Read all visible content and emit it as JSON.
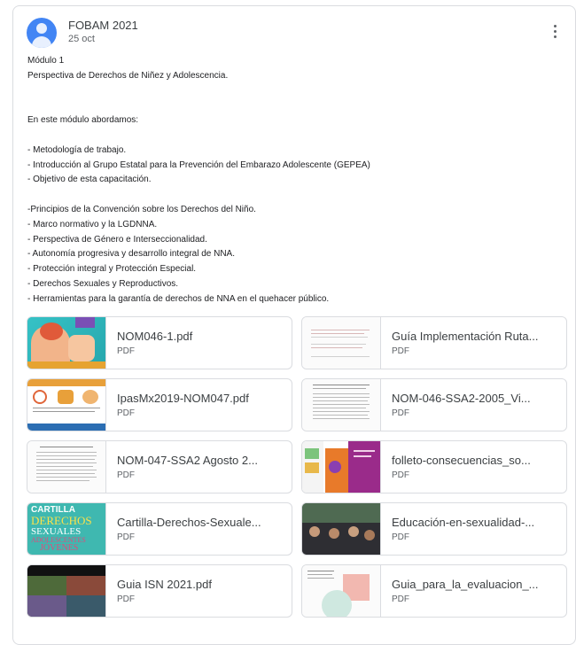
{
  "post": {
    "author": "FOBAM 2021",
    "date": "25 oct",
    "lines": [
      "Módulo 1",
      "Perspectiva de Derechos de Niñez y Adolescencia.",
      "",
      "",
      "En este módulo abordamos:",
      "",
      "- Metodología de trabajo.",
      "- Introducción al Grupo Estatal para la Prevención del Embarazo Adolescente (GEPEA)",
      "- Objetivo de esta capacitación.",
      "",
      "-Principios de la Convención sobre los Derechos del Niño.",
      "- Marco normativo y la LGDNNA.",
      "- Perspectiva de Género e Interseccionalidad.",
      "- Autonomía progresiva y desarrollo integral de NNA.",
      "- Protección integral y Protección Especial.",
      "- Derechos Sexuales y Reproductivos.",
      "- Herramientas para la garantía de derechos de NNA en el quehacer público."
    ]
  },
  "attachments": [
    {
      "name": "NOM046-1.pdf",
      "type": "PDF"
    },
    {
      "name": "Guía Implementación Ruta...",
      "type": "PDF"
    },
    {
      "name": "IpasMx2019-NOM047.pdf",
      "type": "PDF"
    },
    {
      "name": "NOM-046-SSA2-2005_Vi...",
      "type": "PDF"
    },
    {
      "name": "NOM-047-SSA2 Agosto 2...",
      "type": "PDF"
    },
    {
      "name": "folleto-consecuencias_so...",
      "type": "PDF"
    },
    {
      "name": "Cartilla-Derechos-Sexuale...",
      "type": "PDF"
    },
    {
      "name": "Educación-en-sexualidad-...",
      "type": "PDF"
    },
    {
      "name": "Guia ISN 2021.pdf",
      "type": "PDF"
    },
    {
      "name": "Guia_para_la_evaluacion_...",
      "type": "PDF"
    }
  ],
  "thumb_text": {
    "cartilla_1": "CARTILLA",
    "cartilla_2": "DERECHOS",
    "cartilla_3": "SEXUALES",
    "cartilla_4": "ADOLESCENTES",
    "cartilla_5": "JÓVENES"
  },
  "colors": {
    "avatar": "#4285f4",
    "border": "#dadce0"
  }
}
